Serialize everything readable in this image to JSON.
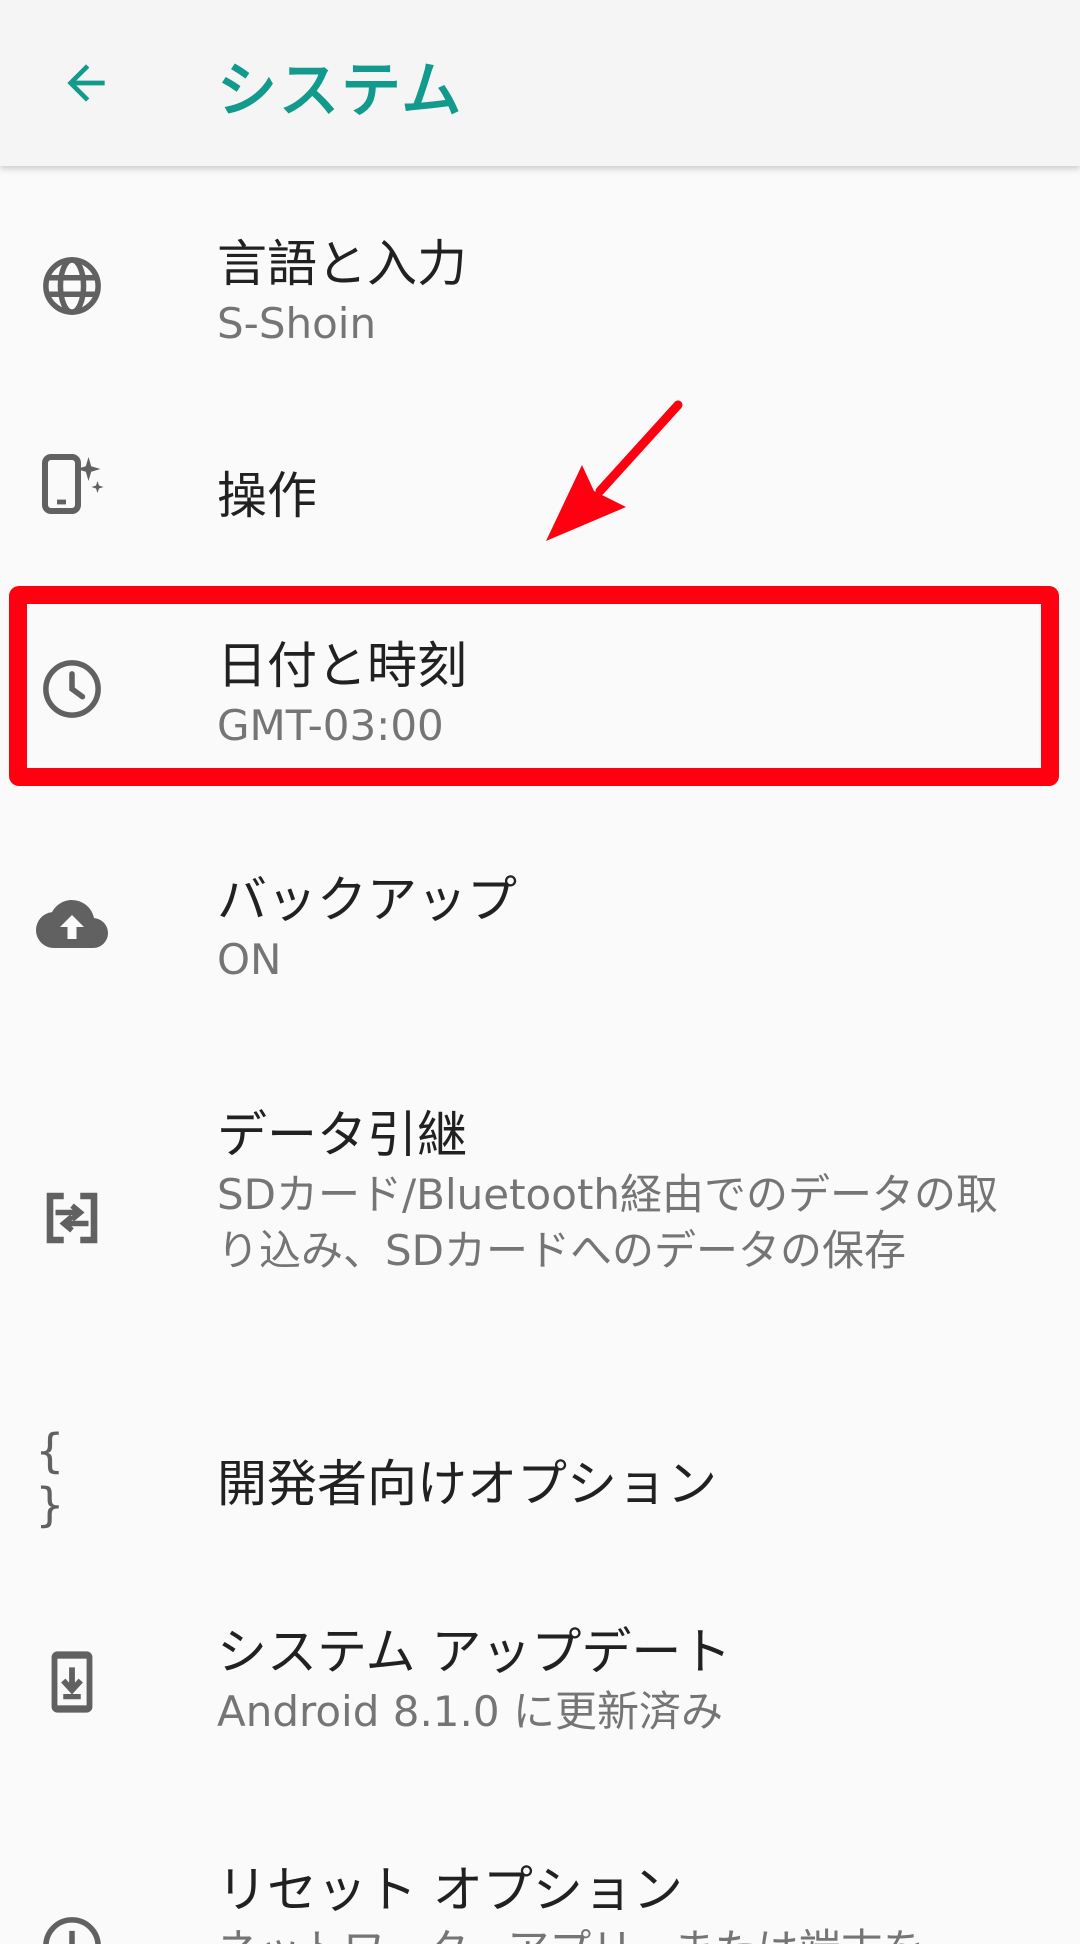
{
  "appbar": {
    "title": "システム",
    "back_icon": "arrow-back-icon",
    "accent_color": "#129a8c"
  },
  "items": [
    {
      "key": "language",
      "title": "言語と入力",
      "summary": "S-Shoin",
      "icon": "globe-icon"
    },
    {
      "key": "gestures",
      "title": "操作",
      "summary": "",
      "icon": "gesture-phone-icon"
    },
    {
      "key": "datetime",
      "title": "日付と時刻",
      "summary": "GMT-03:00",
      "icon": "clock-icon"
    },
    {
      "key": "backup",
      "title": "バックアップ",
      "summary": "ON",
      "icon": "cloud-upload-icon"
    },
    {
      "key": "data-transfer",
      "title": "データ引継",
      "summary": "SDカード/Bluetooth経由でのデータの取り込み、SDカードへのデータの保存",
      "icon": "transfer-icon"
    },
    {
      "key": "developer",
      "title": "開発者向けオプション",
      "summary": "",
      "icon": "braces-icon"
    },
    {
      "key": "system-update",
      "title": "システム アップデート",
      "summary": "Android 8.1.0 に更新済み",
      "icon": "system-update-icon"
    },
    {
      "key": "reset",
      "title": "リセット オプション",
      "summary": "ネットワーク、アプリ、または端末を",
      "icon": "history-icon"
    }
  ],
  "annotation": {
    "highlight_color": "#ff0010"
  }
}
